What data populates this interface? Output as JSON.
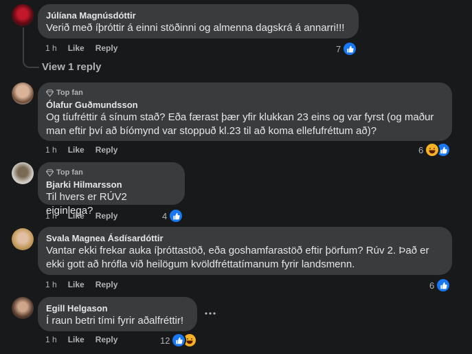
{
  "comments": [
    {
      "author": "Júlíana Magnúsdóttir",
      "badge": "",
      "text": "Verið með íþróttir á einni stöðinni og almenna dagskrá á annarri!!!",
      "time": "1 h",
      "like_label": "Like",
      "reply_label": "Reply",
      "reaction_count": "7",
      "reactions": [
        "like"
      ],
      "view_replies": "View 1 reply"
    },
    {
      "author": "Ólafur Guðmundsson",
      "badge": "Top fan",
      "text_lines": [
        "Og tíufréttir á sínum stað? Eða færast þær yfir klukkan 23 eins og var fyrst (og maður",
        "man eftir því að bíómynd var stoppuð kl.23 til að koma ellefufréttum að)?"
      ],
      "time": "1 h",
      "like_label": "Like",
      "reply_label": "Reply",
      "reaction_count": "6",
      "reactions": [
        "haha",
        "like"
      ]
    },
    {
      "author": "Bjarki Hilmarsson",
      "badge": "Top fan",
      "text": "Til hvers er RÚV2 eiginlega?",
      "time": "1 h",
      "like_label": "Like",
      "reply_label": "Reply",
      "reaction_count": "4",
      "reactions": [
        "like"
      ]
    },
    {
      "author": "Svala Magnea Ásdísardóttir",
      "badge": "",
      "text_lines": [
        "Vantar ekki frekar auka íþróttastöð, eða goshamfarastöð eftir þörfum? Rúv 2. Það er",
        "ekki gott að hrófla við heilögum kvöldfréttatímanum fyrir landsmenn."
      ],
      "time": "1 h",
      "like_label": "Like",
      "reply_label": "Reply",
      "reaction_count": "6",
      "reactions": [
        "like"
      ]
    },
    {
      "author": "Egill Helgason",
      "badge": "",
      "text": "Í raun betri tími fyrir aðalfréttir!",
      "time": "1 h",
      "like_label": "Like",
      "reply_label": "Reply",
      "reaction_count": "12",
      "reactions": [
        "like",
        "haha"
      ],
      "more_icon": "more-horizontal-icon"
    }
  ],
  "colors": {
    "background": "#18191a",
    "bubble": "#3a3b3c",
    "text_primary": "#e4e6eb",
    "text_secondary": "#b0b3b8",
    "like": "#1877f2",
    "haha": "#f7b125"
  }
}
